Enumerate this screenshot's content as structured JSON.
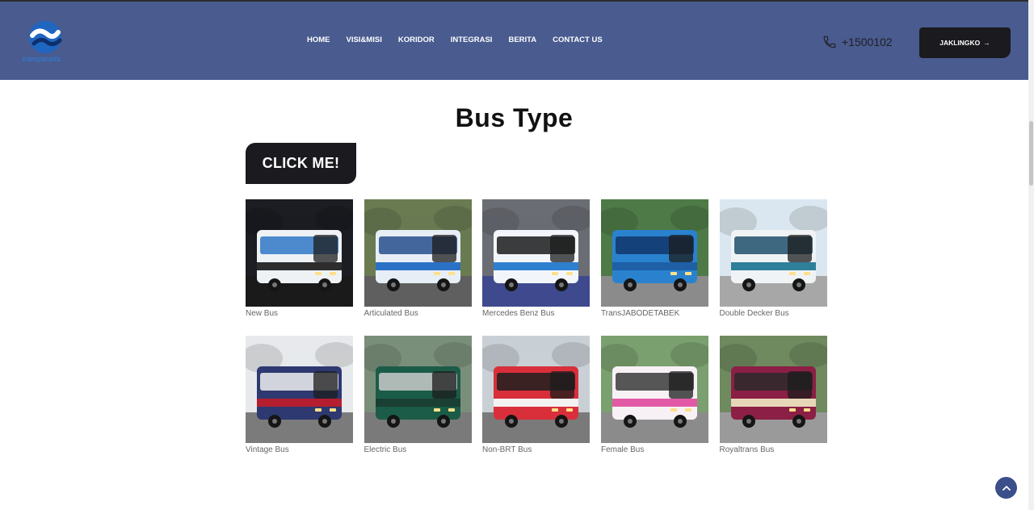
{
  "header": {
    "logo_alt_text": "transjakarta",
    "nav": [
      "HOME",
      "VISI&MISI",
      "KORIDOR",
      "INTEGRASI",
      "BERITA",
      "CONTACT US"
    ],
    "phone": "+1500102",
    "cta_label": "JAKLINGKO",
    "cta_arrow": "→"
  },
  "main": {
    "title": "Bus Type",
    "button_label": "CLICK ME!"
  },
  "buses": [
    {
      "name": "New Bus",
      "theme": {
        "sky": "#1b1d22",
        "ground": "#1a1a1a",
        "body": "#eef2f5",
        "stripe": "#2d2d2d",
        "accent": "#2f78c6"
      }
    },
    {
      "name": "Articulated Bus",
      "theme": {
        "sky": "#6a7b52",
        "ground": "#5f5f5f",
        "body": "#e7eef5",
        "stripe": "#2b72c6",
        "accent": "#264e8d"
      }
    },
    {
      "name": "Mercedes Benz Bus",
      "theme": {
        "sky": "#6a6d73",
        "ground": "#3e4a8d",
        "body": "#f2f6fb",
        "stripe": "#2f7fcf",
        "accent": "#1b1b1b"
      }
    },
    {
      "name": "TransJABODETABEK",
      "theme": {
        "sky": "#4d7a46",
        "ground": "#8b8b8b",
        "body": "#2a82cf",
        "stripe": "#1e5fa6",
        "accent": "#10366a"
      }
    },
    {
      "name": "Double Decker Bus",
      "theme": {
        "sky": "#dbe7f0",
        "ground": "#a7a7a7",
        "body": "#f0f3f5",
        "stripe": "#2f7f9a",
        "accent": "#1f4f6b"
      }
    },
    {
      "name": "Vintage Bus",
      "theme": {
        "sky": "#e7e9ec",
        "ground": "#7b7b7b",
        "body": "#2d3970",
        "stripe": "#b51e2f",
        "accent": "#f0f0f0"
      }
    },
    {
      "name": "Electric Bus",
      "theme": {
        "sky": "#7a8f7a",
        "ground": "#7a7a7a",
        "body": "#1b5c48",
        "stripe": "#1a3f33",
        "accent": "#c9c9c9"
      }
    },
    {
      "name": "Non-BRT Bus",
      "theme": {
        "sky": "#c9d0d5",
        "ground": "#7a7a7a",
        "body": "#d82f3a",
        "stripe": "#f2f2f2",
        "accent": "#1f1f1f"
      }
    },
    {
      "name": "Female Bus",
      "theme": {
        "sky": "#7aa06f",
        "ground": "#8b8b8b",
        "body": "#f7f1f6",
        "stripe": "#e25aa5",
        "accent": "#3b3b3b"
      }
    },
    {
      "name": "Royaltrans Bus",
      "theme": {
        "sky": "#6f8a5f",
        "ground": "#9a9a9a",
        "body": "#8b1f45",
        "stripe": "#e7d7b8",
        "accent": "#2a2a2a"
      }
    }
  ],
  "colors": {
    "header_bg": "#495b8f",
    "dark_button": "#1a1a1f",
    "to_top": "#3b4f8a"
  },
  "icons": [
    "logo-icon",
    "phone-icon",
    "arrow-right-icon",
    "chevron-up-icon"
  ]
}
